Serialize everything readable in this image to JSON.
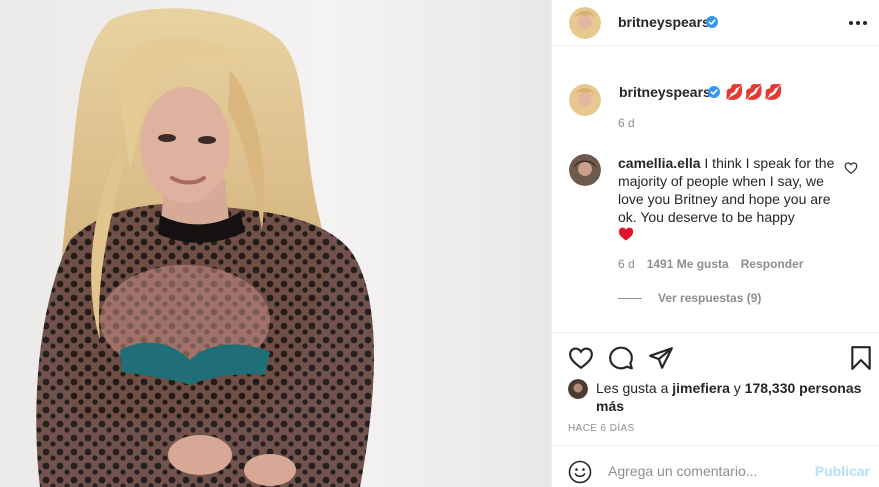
{
  "post": {
    "author": "britneyspears",
    "verified": true,
    "more_icon": "more-horizontal-icon"
  },
  "caption": {
    "username": "britneyspears",
    "text_emoji": "💋💋💋",
    "time": "6 d"
  },
  "comment": {
    "username": "camellia.ella",
    "text": "I think I speak for the majority of people when I say, we love you Britney and hope you are ok. You deserve to be happy",
    "emoji": "heart-emoji",
    "time": "6 d",
    "likes": "1491 Me gusta",
    "reply_label": "Responder",
    "view_replies": "Ver respuestas (9)"
  },
  "actions": {
    "like_icon": "heart-icon",
    "comment_icon": "comment-icon",
    "share_icon": "paper-plane-icon",
    "save_icon": "bookmark-icon"
  },
  "likes": {
    "prefix": "Les gusta a",
    "user": "jimefiera",
    "conj": "y",
    "count": "178,330 personas más"
  },
  "timestamp": "HACE 6 DÍAS",
  "add_comment": {
    "placeholder": "Agrega un comentario...",
    "post_label": "Publicar"
  },
  "colors": {
    "verified_blue": "#3897f0",
    "text": "#262626",
    "muted": "#8e8e8e",
    "post_disabled": "#b2dffc",
    "heart_red": "#ed4956"
  }
}
